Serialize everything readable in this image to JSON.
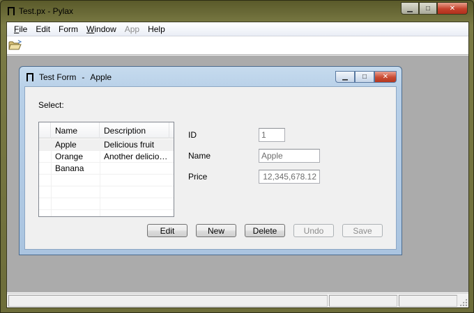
{
  "window": {
    "title": "Test.px - Pylax",
    "minimize_glyph": "▁",
    "maximize_glyph": "□",
    "close_glyph": "✕"
  },
  "menu": [
    {
      "label": "File",
      "accel_char": "F",
      "rest": "ile",
      "enabled": true
    },
    {
      "label": "Edit",
      "enabled": true
    },
    {
      "label": "Form",
      "enabled": true
    },
    {
      "label": "Window",
      "accel_char": "W",
      "rest": "indow",
      "enabled": true
    },
    {
      "label": "App",
      "enabled": false
    },
    {
      "label": "Help",
      "enabled": true
    }
  ],
  "toolbar": {
    "open_icon": "folder-open-icon"
  },
  "child": {
    "title_prefix": "Test Form",
    "title_sep": "-",
    "title_record": "Apple",
    "minimize_glyph": "▁",
    "maximize_glyph": "□",
    "close_glyph": "✕"
  },
  "form": {
    "select_label": "Select:",
    "list": {
      "columns": [
        "Name",
        "Description"
      ],
      "rows": [
        {
          "name": "Apple",
          "description": "Delicious fruit",
          "selected": true
        },
        {
          "name": "Orange",
          "description": "Another deliciou...",
          "selected": false
        },
        {
          "name": "Banana",
          "description": "",
          "selected": false
        }
      ]
    },
    "fields": {
      "id_label": "ID",
      "id_value": "1",
      "name_label": "Name",
      "name_value": "Apple",
      "price_label": "Price",
      "price_value": "12,345,678.12"
    },
    "buttons": {
      "edit": "Edit",
      "new": "New",
      "delete": "Delete",
      "undo": "Undo",
      "save": "Save"
    }
  }
}
